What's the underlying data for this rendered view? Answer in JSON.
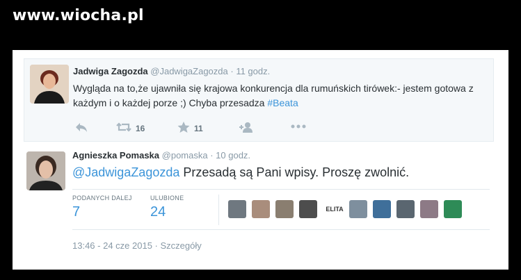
{
  "watermark": "www.wiocha.pl",
  "tweet1": {
    "name": "Jadwiga Zagozda",
    "handle": "@JadwigaZagozda",
    "time": "· 11 godz.",
    "text": "Wygląda na to,że ujawniła się krajowa konkurencja dla rumuńskich tirówek:- jestem gotowa z każdym i o każdej porze ;) Chyba przesadza ",
    "hashtag": "#Beata",
    "retweets": "16",
    "favorites": "11"
  },
  "tweet2": {
    "name": "Agnieszka Pomaska",
    "handle": "@pomaska",
    "time": "· 10 godz.",
    "mention": "@JadwigaZagozda",
    "text": " Przesadą są Pani wpisy. Proszę zwolnić.",
    "retweets_label": "PODANYCH DALEJ",
    "retweets_value": "7",
    "favorites_label": "ULUBIONE",
    "favorites_value": "24",
    "elita_label": "ELITA",
    "timestamp": "13:46 - 24 cze 2015",
    "details": "· Szczegóły"
  },
  "colors": {
    "link": "#3b94d9",
    "text": "#292f33",
    "muted": "#8899a6"
  }
}
